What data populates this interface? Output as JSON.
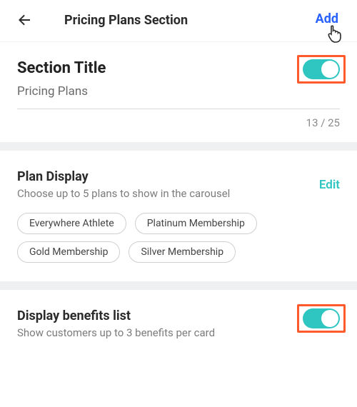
{
  "header": {
    "title": "Pricing Plans Section",
    "add_label": "Add"
  },
  "section_title": {
    "label": "Section Title",
    "value": "Pricing Plans",
    "count": "13 / 25",
    "toggle_on": true
  },
  "plan_display": {
    "title": "Plan Display",
    "desc": "Choose up to 5 plans to show in the carousel",
    "edit_label": "Edit",
    "chips": [
      "Everywhere Athlete",
      "Platinum Membership",
      "Gold Membership",
      "Silver Membership"
    ]
  },
  "benefits": {
    "title": "Display benefits list",
    "desc": "Show customers up to 3 benefits per card",
    "toggle_on": true
  },
  "colors": {
    "accent_link": "#2a62ff",
    "accent_teal": "#2fc6c2",
    "highlight_box": "#ff5a2b"
  }
}
